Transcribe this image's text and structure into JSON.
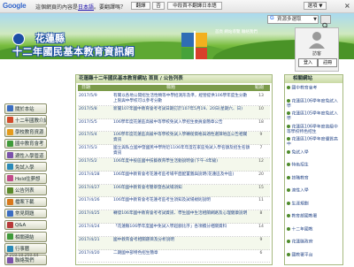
{
  "translate_bar": {
    "logo": "Google",
    "message_pre": "這個網頁的內容是",
    "language_link": "日本語",
    "message_post": "。要翻譯嗎？",
    "translate_button": "翻譯",
    "no_button": "否",
    "never_button": "中段首不翻譯日本語",
    "options_button": "選項 ▼",
    "close": "×"
  },
  "header": {
    "title_line1": "花蓮縣",
    "title_line2": "十二年國民基本教育資訊網",
    "links": "首頁  網站導覽  聯絡我們",
    "logo_caption": "十二年國民基本教育"
  },
  "search": {
    "placeholder": "資源多選取",
    "icon": "search-icon"
  },
  "user": {
    "name": "訪客",
    "login_button": "登入",
    "register_button": "註冊"
  },
  "leftnav": {
    "items": [
      {
        "label": "關於本站",
        "color": "#3b6dc2"
      },
      {
        "label": "十二年國教介紹",
        "color": "#d24b2b"
      },
      {
        "label": "學校教育資源",
        "color": "#e59b1b"
      },
      {
        "label": "國中教育會考",
        "color": "#3f9a3a"
      },
      {
        "label": "適性入學管道",
        "color": "#7b52ab"
      },
      {
        "label": "免試入學",
        "color": "#2a8ab8"
      },
      {
        "label": "Hold住夢想",
        "color": "#c24a8a"
      },
      {
        "label": "公告列表",
        "color": "#5a8a2a"
      },
      {
        "label": "檔案下載",
        "color": "#d9781b"
      },
      {
        "label": "常見問題",
        "color": "#3b6dc2"
      },
      {
        "label": "Q&A",
        "color": "#b83a3a"
      },
      {
        "label": "相關連結",
        "color": "#3f9a3a"
      },
      {
        "label": "行事曆",
        "color": "#2a8ab8"
      },
      {
        "label": "聯絡我們",
        "color": "#7b52ab"
      }
    ],
    "visitor_count": "IP 218.18.250.44"
  },
  "main": {
    "title": "花蓮縣十二年國民基本教育網站 首頁 / 公告列表",
    "columns": [
      "日期",
      "標題",
      "點閱"
    ],
    "rows": [
      {
        "date": "2017/5/9",
        "title": "有關以各地公開招生活性類等中學招測形及準，經營提供106學年度生分數上限與中學校可以參考分數",
        "hits": "13"
      },
      {
        "date": "2017/5/8",
        "title": "新聞107年國中教育會考考試日期訂於107年5月19、20日(星期六、日)",
        "hits": "10"
      },
      {
        "date": "2017/5/5",
        "title": "106學年度花蓮區高級中等學校免試入學招生委員會簡章公告",
        "hits": "18"
      },
      {
        "date": "2017/5/4",
        "title": "106學年度花蓮區高級中等學校免試入學轉銜資格與適性選擇地區公告相關資訊",
        "hits": "9"
      },
      {
        "date": "2017/5/3",
        "title": "國立與私立國中暨國民中學附近1106年年度在家區免試入學名額及招生名額資訊",
        "hits": "7"
      },
      {
        "date": "2017/5/2",
        "title": "106年度中投區國中技藝教育學生活動說明會(下午-4年級)",
        "hits": "12"
      },
      {
        "date": "2017/4/28",
        "title": "106年國中教育會考花蓮考區考場平面配置圖與說明(花蓮區及中區)",
        "hits": "20"
      },
      {
        "date": "2017/4/27",
        "title": "106年國中教育會考簡章暨各試場須知",
        "hits": "15"
      },
      {
        "date": "2017/4/26",
        "title": "106年國中教育會考花蓮考區考生須知及試場規則說明",
        "hits": "11"
      },
      {
        "date": "2017/4/25",
        "title": "轉發106年國中教育會考考試資訊、學生國中生活相關網路及心理健康說明",
        "hits": "8"
      },
      {
        "date": "2017/4/24",
        "title": "「花蓮縣106學年度國中免試入學超額比序」各項積分相關資料",
        "hits": "14"
      },
      {
        "date": "2017/4/21",
        "title": "國中教育會考相關題目及分析說明",
        "hits": "9"
      },
      {
        "date": "2017/4/20",
        "title": "二期國中部特色招生簡章",
        "hits": "6"
      }
    ]
  },
  "rpanel": {
    "title": "相關網站",
    "items": [
      "國中教育會考",
      "花蓮區106學年度免試入學",
      "花蓮區105學年度免試入學",
      "花蓮區106學年度高級中等學校特色招生",
      "花蓮區106學年度優質高中",
      "免試入學",
      "特色招生",
      "技職教育",
      "適性入學",
      "生涯規劃",
      "教育部國教署",
      "十二年國教",
      "花蓮縣政府",
      "國教署平台"
    ]
  }
}
